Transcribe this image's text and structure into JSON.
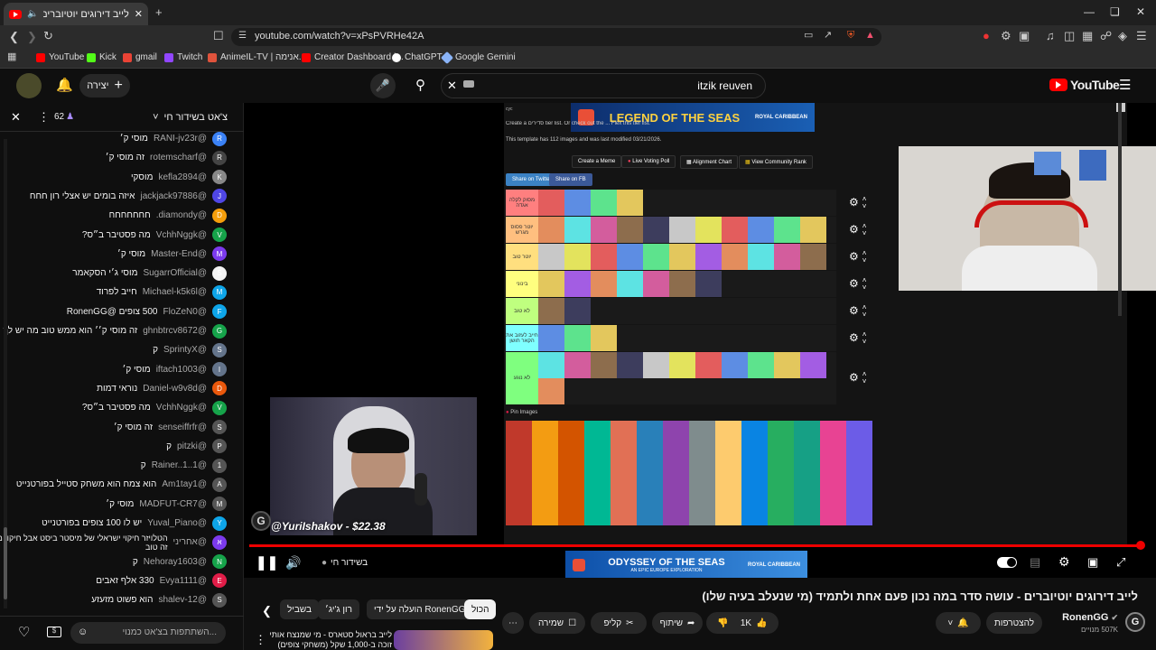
{
  "browser": {
    "tab_title": "לייב דירוגים יוטיוברים - עושה",
    "url": "youtube.com/watch?v=xPsPVRHe42A",
    "bookmarks": [
      {
        "label": "YouTube",
        "color": "#ff0000"
      },
      {
        "label": "Kick",
        "color": "#53fc18"
      },
      {
        "label": "gmail",
        "color": "#ea4335"
      },
      {
        "label": "Twitch",
        "color": "#9146ff"
      },
      {
        "label": "AnimeIL-TV | אנימה...",
        "color": "#e0533c"
      },
      {
        "label": "Creator Dashboard |...",
        "color": "#ff0000"
      },
      {
        "label": "ChatGPT",
        "color": "#ffffff"
      },
      {
        "label": "Google Gemini",
        "color": "#8ab4f8"
      }
    ]
  },
  "yt_header": {
    "search_query": "itzik reuven",
    "create_label": "יצירה",
    "logo_text": "YouTube"
  },
  "chat": {
    "title": "צ'אט בשידור חי",
    "viewer_count": "62",
    "input_placeholder": "השתתפות בצ'אט כמנוי...",
    "messages": [
      {
        "author": "@RANI-jv23r",
        "text": "מוסי ק׳",
        "color": "#3b82f6"
      },
      {
        "author": "@rotemscharf",
        "text": "זה מוסי ק׳",
        "color": "#444"
      },
      {
        "author": "@kefla2894",
        "text": "מוסקי",
        "color": "#888"
      },
      {
        "author": "@jackjack97886",
        "text": "איזה בומים יש אצלי רון חחח",
        "color": "#4f46e5"
      },
      {
        "author": "@diamondy.",
        "text": "חחחחחחח",
        "color": "#f59e0b"
      },
      {
        "author": "@VchhNggk",
        "text": "מה פסטיבר ב״ס?",
        "color": "#16a34a"
      },
      {
        "author": "@Master-End",
        "text": "מוסי ק׳",
        "color": "#7c3aed"
      },
      {
        "author": "@SugarrOfficial",
        "text": "מוסי ג׳י הסקאמר",
        "color": "#f3f3f3"
      },
      {
        "author": "@Michael-k5k6l",
        "text": "חייב לפרוד",
        "color": "#0ea5e9"
      },
      {
        "author": "@FloZeN0",
        "text": "500 צופים @RonenGG",
        "color": "#0ea5e9"
      },
      {
        "author": "@ghnbtrcv8672",
        "text": "זה מוסי ק׳׳ הוא ממש טוב מה יש לך",
        "color": "#16a34a"
      },
      {
        "author": "@SprintyX",
        "text": "ק",
        "color": "#64748b"
      },
      {
        "author": "@iftach1003",
        "text": "מוסי ק׳",
        "color": "#64748b"
      },
      {
        "author": "@Daniel-w9v8d",
        "text": "נוראי דמות",
        "color": "#ea580c"
      },
      {
        "author": "@VchhNggk",
        "text": "מה פסטיבר ב״ס?",
        "color": "#16a34a"
      },
      {
        "author": "@senseiffrfr",
        "text": "זה מוסי ק׳",
        "color": "#555"
      },
      {
        "author": "@pitzki",
        "text": "ק",
        "color": "#555"
      },
      {
        "author": "@1..Rainer..1",
        "text": "ק",
        "color": "#555"
      },
      {
        "author": "@Am1tay1",
        "text": "הוא צמח הוא משחק סטייל בפורטנייט",
        "color": "#555"
      },
      {
        "author": "@MADFUT-CR7",
        "text": "מוסי ק׳",
        "color": "#555"
      },
      {
        "author": "@Yuval_Piano",
        "text": "יש לו 100 צופים בפורטנייט",
        "color": "#0ea5e9"
      },
      {
        "author": "@אחריני",
        "text": "הטלויזר חיקוי ישראלי של מיסטר ביסט אבל חיקוי מה זה טוב",
        "color": "#7c3aed"
      },
      {
        "author": "@Nehoray1603",
        "text": "ק",
        "color": "#16a34a"
      },
      {
        "author": "@Evya1111",
        "text": "330 אלף זאבים",
        "color": "#e11d48"
      },
      {
        "author": "@shalev-12",
        "text": "הוא פשוט מזעזע",
        "color": "#555"
      }
    ]
  },
  "tierlist": {
    "header_text": "Create a סדירים tier list. Or check out the ... Flex this tier list.",
    "template_info": "This template has 112 images and was last modified 03/21/2026.",
    "buttons": [
      "Create a Meme",
      "Live Voting Poll",
      "Alignment Chart",
      "View Community Rank"
    ],
    "share_buttons": [
      "Share on Twitter",
      "Share on FB"
    ],
    "pin_images_label": "Pin Images",
    "tiers": [
      {
        "label": "מסוק לקלה אגדה",
        "color": "#ff7f7f",
        "count": 4
      },
      {
        "label": "יוטר פסוס מגרש",
        "color": "#ffbf7f",
        "count": 11
      },
      {
        "label": "יוטר טוב",
        "color": "#ffdf7f",
        "count": 11
      },
      {
        "label": "בינוני",
        "color": "#ffff7f",
        "count": 7
      },
      {
        "label": "לא טוב",
        "color": "#bfff7f",
        "count": 2
      },
      {
        "label": "חייב לעזוב את הקאר חושן",
        "color": "#7fffff",
        "count": 3
      },
      {
        "label": "לא נוגע",
        "color": "#7fff7f",
        "count": 12
      }
    ]
  },
  "ads": {
    "top_ad": "LEGEND OF THE SEAS",
    "top_ad_brand": "ROYAL CARIBBEAN",
    "bottom_ad": "ODYSSEY OF THE SEAS",
    "bottom_ad_sub": "AN EPIC EUROPE EXPLORATION",
    "bottom_ad_brand": "ROYAL CARIBBEAN"
  },
  "player": {
    "donation_text": "@YuriIshakov - $22.38",
    "live_label": "בשידור חי",
    "progress_fraction": 1.0
  },
  "video": {
    "title": "לייב דירוגים יוטיוברים - עושה סדר במה נכון פעם אחת ולתמיד (מי שנעלב בעיה שלו)",
    "channel": "RonenGG",
    "subscribers": "507K מנויים",
    "join_label": "להצטרפות",
    "likes": "1K",
    "share_label": "שיתוף",
    "clip_label": "קליפ",
    "save_label": "שמירה",
    "chips": [
      "הכול",
      "הועלה על ידי RonenGG",
      "רון ג'יג׳",
      "בשביל"
    ],
    "rec_title": "לייב בראול סטארס - מי שמנצח אותי זוכה ב-1,000 שקל (משחקי צופים)"
  }
}
